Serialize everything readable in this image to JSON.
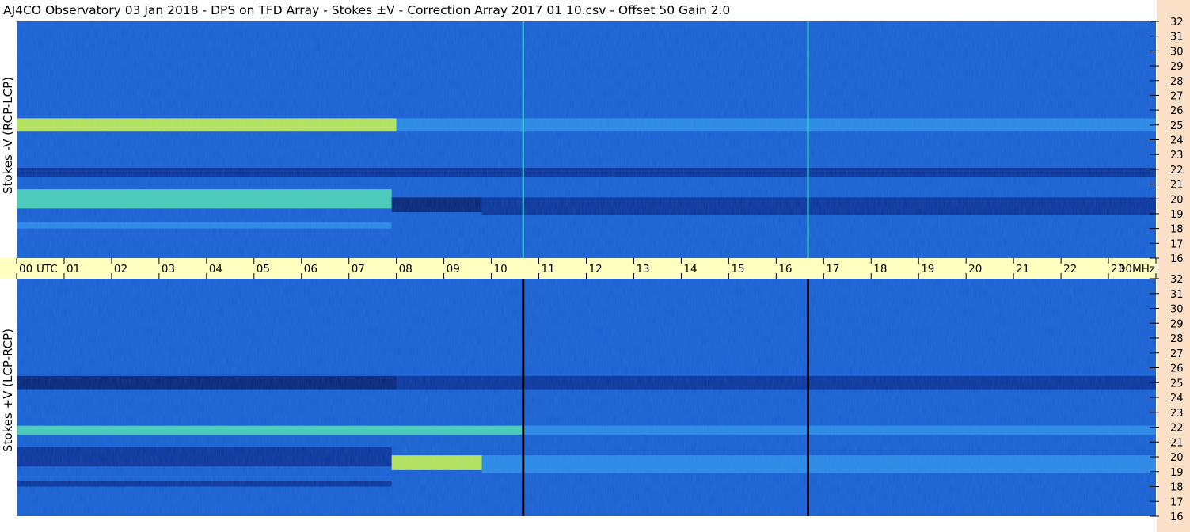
{
  "title": "AJ4CO Observatory  03 Jan 2018  -  DPS on TFD Array  -  Stokes ±V  -  Correction Array 2017 01 10.csv  -  Offset 50  Gain 2.0",
  "colors": {
    "time_axis_band": "#ffffc0",
    "freq_axis_strip": "#fde0c8",
    "spectrogram_base": "#1a5fd0",
    "spectrogram_dark": "#061a66",
    "spectrogram_bright": "#55e0b0",
    "spectrogram_hot": "#d8ff40"
  },
  "chart_data": {
    "type": "heatmap",
    "time_axis": {
      "unit_label": "UTC",
      "ticks": [
        "00",
        "01",
        "02",
        "03",
        "04",
        "05",
        "06",
        "07",
        "08",
        "09",
        "10",
        "11",
        "12",
        "13",
        "14",
        "15",
        "16",
        "17",
        "18",
        "19",
        "20",
        "21",
        "22",
        "23",
        "00"
      ],
      "range_hours": [
        0,
        24
      ]
    },
    "frequency_axis": {
      "unit_label": "MHz",
      "ticks": [
        "32",
        "31",
        "30",
        "29",
        "28",
        "27",
        "26",
        "25",
        "24",
        "23",
        "22",
        "21",
        "20",
        "19",
        "18",
        "17",
        "16"
      ],
      "range_mhz": [
        16,
        32
      ]
    },
    "panels": [
      {
        "label": "Stokes -V (RCP-LCP)",
        "polarity": -1,
        "vertical_lines": [
          {
            "time_hours": 10.67,
            "style": "bright"
          },
          {
            "time_hours": 16.67,
            "style": "bright"
          }
        ]
      },
      {
        "label": "Stokes +V (LCP-RCP)",
        "polarity": 1,
        "vertical_lines": [
          {
            "time_hours": 10.67,
            "style": "dark"
          },
          {
            "time_hours": 16.67,
            "style": "dark"
          }
        ]
      }
    ],
    "bands": [
      {
        "freq_mhz": 25.0,
        "width_mhz": 0.9,
        "value": -1.0,
        "t_start": 0,
        "t_end": 8
      },
      {
        "freq_mhz": 25.0,
        "width_mhz": 0.9,
        "value": -0.5,
        "t_start": 8,
        "t_end": 24
      },
      {
        "freq_mhz": 21.8,
        "width_mhz": 0.6,
        "value": 0.8,
        "t_start": 0,
        "t_end": 10.7
      },
      {
        "freq_mhz": 21.8,
        "width_mhz": 0.6,
        "value": 0.4,
        "t_start": 10.7,
        "t_end": 24
      },
      {
        "freq_mhz": 20.0,
        "width_mhz": 1.3,
        "value": -0.8,
        "t_start": 0,
        "t_end": 7.9
      },
      {
        "freq_mhz": 19.6,
        "width_mhz": 1.0,
        "value": 0.9,
        "t_start": 7.9,
        "t_end": 9.8
      },
      {
        "freq_mhz": 19.5,
        "width_mhz": 1.2,
        "value": 0.4,
        "t_start": 9.8,
        "t_end": 24
      },
      {
        "freq_mhz": 18.2,
        "width_mhz": 0.4,
        "value": -0.4,
        "t_start": 0,
        "t_end": 7.9
      }
    ]
  }
}
